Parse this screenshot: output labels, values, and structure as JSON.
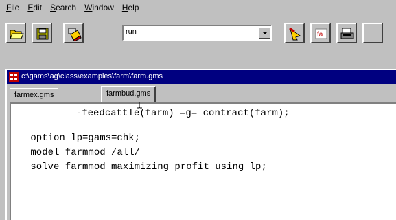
{
  "menubar": {
    "items": [
      {
        "acc": "F",
        "rest": "ile"
      },
      {
        "acc": "E",
        "rest": "dit"
      },
      {
        "acc": "S",
        "rest": "earch"
      },
      {
        "acc": "W",
        "rest": "indow"
      },
      {
        "acc": "H",
        "rest": "elp"
      }
    ]
  },
  "toolbar": {
    "combo_value": "run"
  },
  "document": {
    "title": "c:\\gams\\ag\\class\\examples\\farm\\farm.gms",
    "tabs": [
      "farmex.gms",
      "farmbud.gms"
    ],
    "active_tab": "farmbud.gms",
    "code_lines": [
      "       -feedcattle(farm) =g= contract(farm);",
      "",
      " option lp=gams=chk;",
      " model farmmod /all/",
      " solve farmmod maximizing profit using lp;"
    ]
  },
  "colors": {
    "title_bar": "#000080",
    "window_face": "#c0c0c0"
  }
}
